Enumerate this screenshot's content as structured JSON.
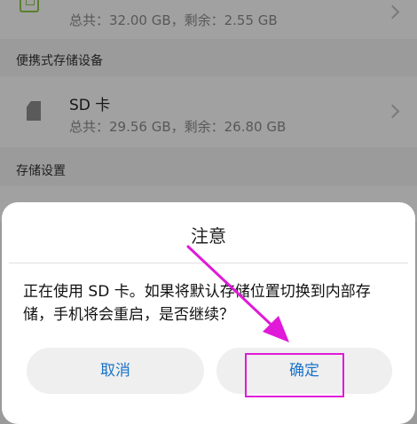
{
  "storage": {
    "internal": {
      "summary": "总共：32.00 GB，剩余：2.55 GB"
    },
    "portable_header": "便携式存储设备",
    "sd_card": {
      "name": "SD 卡",
      "summary": "总共：29.56 GB，剩余：26.80 GB"
    },
    "settings_header": "存储设置"
  },
  "dialog": {
    "title": "注意",
    "message": "正在使用 SD 卡。如果将默认存储位置切换到内部存储，手机将会重启，是否继续？",
    "cancel_label": "取消",
    "confirm_label": "确定"
  },
  "colors": {
    "accent": "#1a73c8",
    "annotation": "#e01ad8",
    "storage_icon": "#8bc34a"
  },
  "icons": [
    "chip-icon",
    "sd-card-icon",
    "chevron-right-icon",
    "arrow-annotation-icon"
  ]
}
